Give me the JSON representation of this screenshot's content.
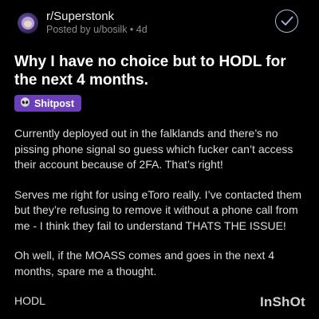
{
  "post": {
    "subreddit": "r/Superstonk",
    "posted_by": "Posted by u/bosilk • 4d",
    "title": "Why I have no choice but to HODL for the next 4 months.",
    "flair": {
      "icon": "alien-icon",
      "label": "Shitpost",
      "color": "#6a3fb8"
    },
    "paragraphs": [
      "Currently deployed out in the falklands and there’s no pissing phone signal so guess which fucker can’t access their account because of 2FA. That’s right!",
      "Serves me right for using eToro really. I’ve contacted them but they’re refusing to remove it without a phone call from me - I think they fail to understand THATS THE ISSUE!",
      "Oh well, if the MOASS comes and goes in the next 4 months, spare me a thought.",
      "HODL"
    ]
  },
  "header": {
    "action_icon": "checkmark-circle-icon"
  },
  "watermark": {
    "text": "InShOt"
  },
  "colors": {
    "background": "#000000",
    "accent": "#a9b8e6",
    "flair": "#6a3fb8"
  }
}
